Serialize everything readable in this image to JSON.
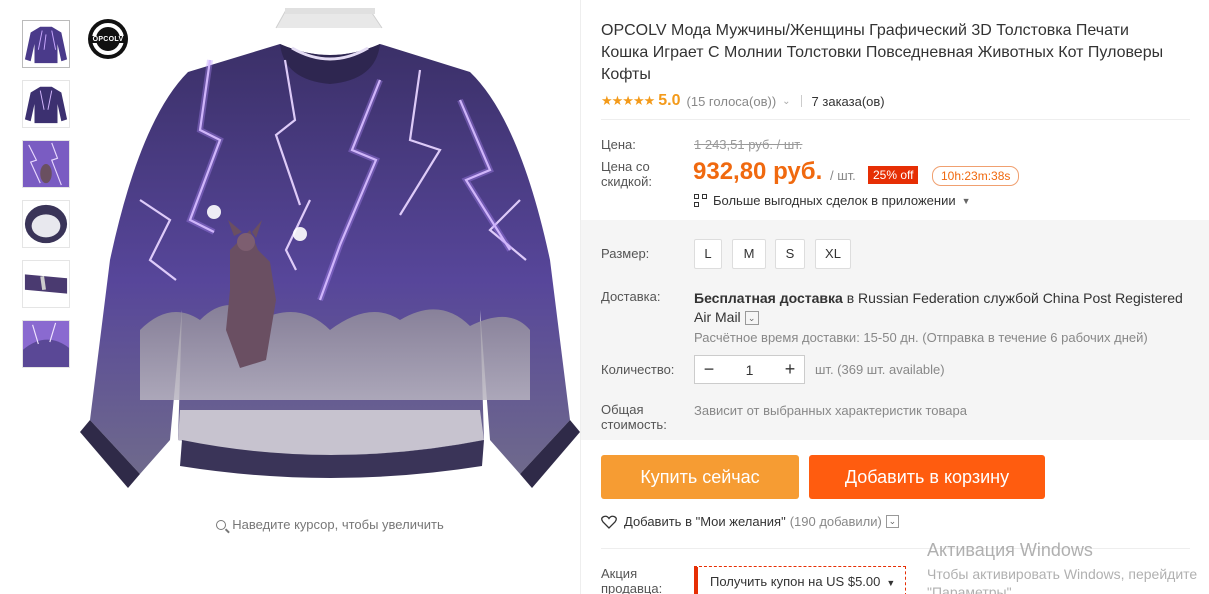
{
  "product": {
    "title": "OPCOLV Мода Мужчины/Женщины Графический 3D Толстовка Печати Кошка Играет С Молнии Толстовки Повседневная Животных Кот Пуловеры Кофты",
    "brand_logo_text": "OPCOLV",
    "zoom_hint": "Наведите курсор, чтобы увеличить",
    "thumbnails_count": 6
  },
  "rating": {
    "stars": "★★★★★",
    "value": "5.0",
    "votes": "(15 голоса(ов))",
    "orders": "7 заказа(ов)"
  },
  "price": {
    "label": "Цена:",
    "old": "1 243,51 руб. / шт.",
    "discount_label": "Цена со скидкой:",
    "new": "932,80 руб.",
    "per_unit": "/ шт.",
    "discount_badge": "25% off",
    "timer": "10h:23m:38s",
    "app_deals": "Больше выгодных сделок в приложении"
  },
  "size": {
    "label": "Размер:",
    "options": [
      "L",
      "M",
      "S",
      "XL"
    ]
  },
  "shipping": {
    "label": "Доставка:",
    "free_prefix": "Бесплатная доставка",
    "main_rest": " в Russian Federation службой China Post Registered Air Mail",
    "estimate": "Расчётное время доставки: 15-50 дн. (Отправка в течение 6 рабочих дней)"
  },
  "quantity": {
    "label": "Количество:",
    "value": "1",
    "available": "шт. (369 шт. available)"
  },
  "total": {
    "label": "Общая стоимость:",
    "value": "Зависит от выбранных характеристик товара"
  },
  "actions": {
    "buy_now": "Купить сейчас",
    "add_to_cart": "Добавить в корзину",
    "wishlist": "Добавить в \"Мои желания\"",
    "wishlist_count": "(190 добавили)"
  },
  "seller_promo": {
    "label": "Акция продавца:",
    "coupon": "Получить купон на US $5.00"
  },
  "windows_watermark": {
    "line1": "Активация Windows",
    "line2": "Чтобы активировать Windows, перейдите",
    "line3": "\"Параметры\""
  },
  "colors": {
    "accent_orange": "#f0690f",
    "buy_button": "#f69c33",
    "cart_button": "#ff5c0f",
    "discount_red": "#e62e04",
    "star": "#f39a1a"
  }
}
